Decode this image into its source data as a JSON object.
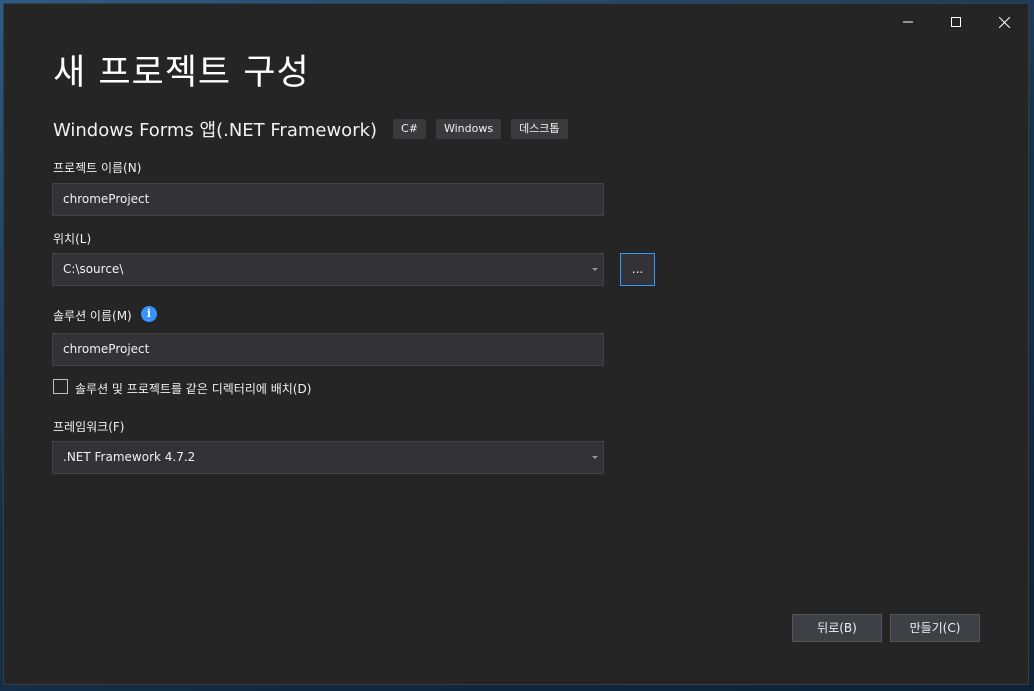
{
  "window": {
    "title": "새 프로젝트 구성",
    "caption_buttons": [
      "minimize-icon",
      "maximize-icon",
      "close-icon"
    ]
  },
  "template": {
    "name": "Windows Forms 앱(.NET Framework)",
    "tags": [
      "C#",
      "Windows",
      "데스크톱"
    ]
  },
  "form": {
    "project_name": {
      "label": "프로젝트 이름(N)",
      "value": "chromeProject"
    },
    "location": {
      "label": "위치(L)",
      "value": "C:\\source\\",
      "browse_label": "..."
    },
    "solution_name": {
      "label": "솔루션 이름(M)",
      "value": "chromeProject",
      "info_icon": "i"
    },
    "same_directory": {
      "label": "솔루션 및 프로젝트를 같은 디렉터리에 배치(D)",
      "checked": false
    },
    "framework": {
      "label": "프레임워크(F)",
      "value": ".NET Framework 4.7.2"
    }
  },
  "buttons": {
    "back": "뒤로(B)",
    "create": "만들기(C)"
  },
  "colors": {
    "window_bg": "#252526",
    "field_bg": "#333337",
    "focus_border": "#3399ff",
    "info_blue": "#3794ff"
  }
}
